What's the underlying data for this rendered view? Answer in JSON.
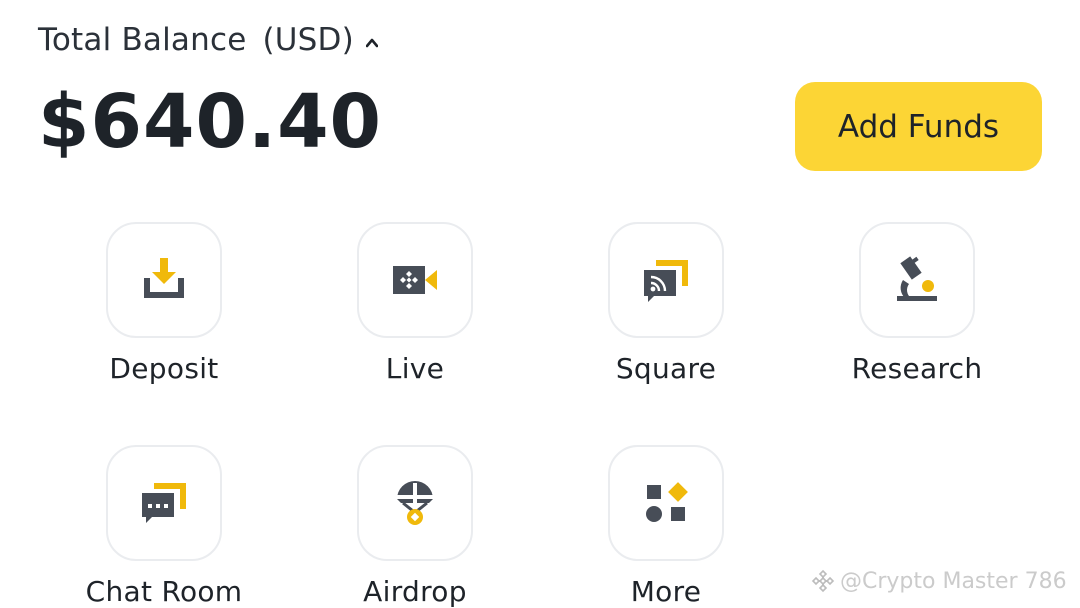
{
  "balance": {
    "label": "Total Balance",
    "currency": "(USD)",
    "amount": "$640.40",
    "toggle_icon": "chevron-up-icon"
  },
  "add_funds": {
    "label": "Add Funds"
  },
  "shortcuts": [
    {
      "label": "Deposit",
      "icon": "deposit-icon"
    },
    {
      "label": "Live",
      "icon": "live-video-icon"
    },
    {
      "label": "Square",
      "icon": "square-feed-icon"
    },
    {
      "label": "Research",
      "icon": "microscope-icon"
    },
    {
      "label": "Chat Room",
      "icon": "chat-room-icon"
    },
    {
      "label": "Airdrop",
      "icon": "airdrop-parachute-icon"
    },
    {
      "label": "More",
      "icon": "more-grid-icon"
    }
  ],
  "watermark": {
    "text": "@Crypto Master 786"
  },
  "colors": {
    "accent": "#fcd535",
    "icon_dark": "#474d57",
    "icon_yellow": "#f0b90b",
    "text": "#1e2329"
  }
}
